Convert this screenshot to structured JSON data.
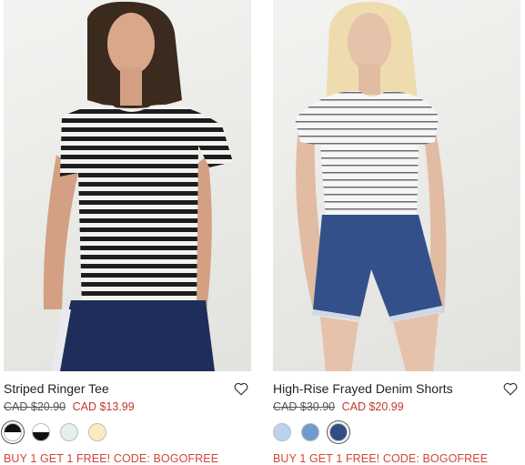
{
  "products": [
    {
      "name": "Striped Ringer Tee",
      "old_price": "CAD $20.90",
      "new_price": "CAD $13.99",
      "promo": "BUY 1 GET 1 FREE! CODE: BOGOFREE",
      "swatches": [
        {
          "name": "black-white",
          "colors": [
            "#111111",
            "#ffffff"
          ]
        },
        {
          "name": "white-black",
          "colors": [
            "#ffffff",
            "#111111"
          ]
        },
        {
          "name": "mint",
          "colors": [
            "#e3f0ec"
          ]
        },
        {
          "name": "cream",
          "colors": [
            "#fde9c2"
          ]
        }
      ]
    },
    {
      "name": "High-Rise Frayed Denim Shorts",
      "old_price": "CAD $30.90",
      "new_price": "CAD $20.99",
      "promo": "BUY 1 GET 1 FREE! CODE: BOGOFREE",
      "swatches": [
        {
          "name": "light-denim",
          "colors": [
            "#bcd3ee"
          ]
        },
        {
          "name": "medium-denim",
          "colors": [
            "#6f9bcf"
          ]
        },
        {
          "name": "dark-denim",
          "colors": [
            "#2f4d86"
          ]
        }
      ]
    }
  ],
  "colors": {
    "sale": "#c0392b",
    "promo": "#d0463a"
  }
}
